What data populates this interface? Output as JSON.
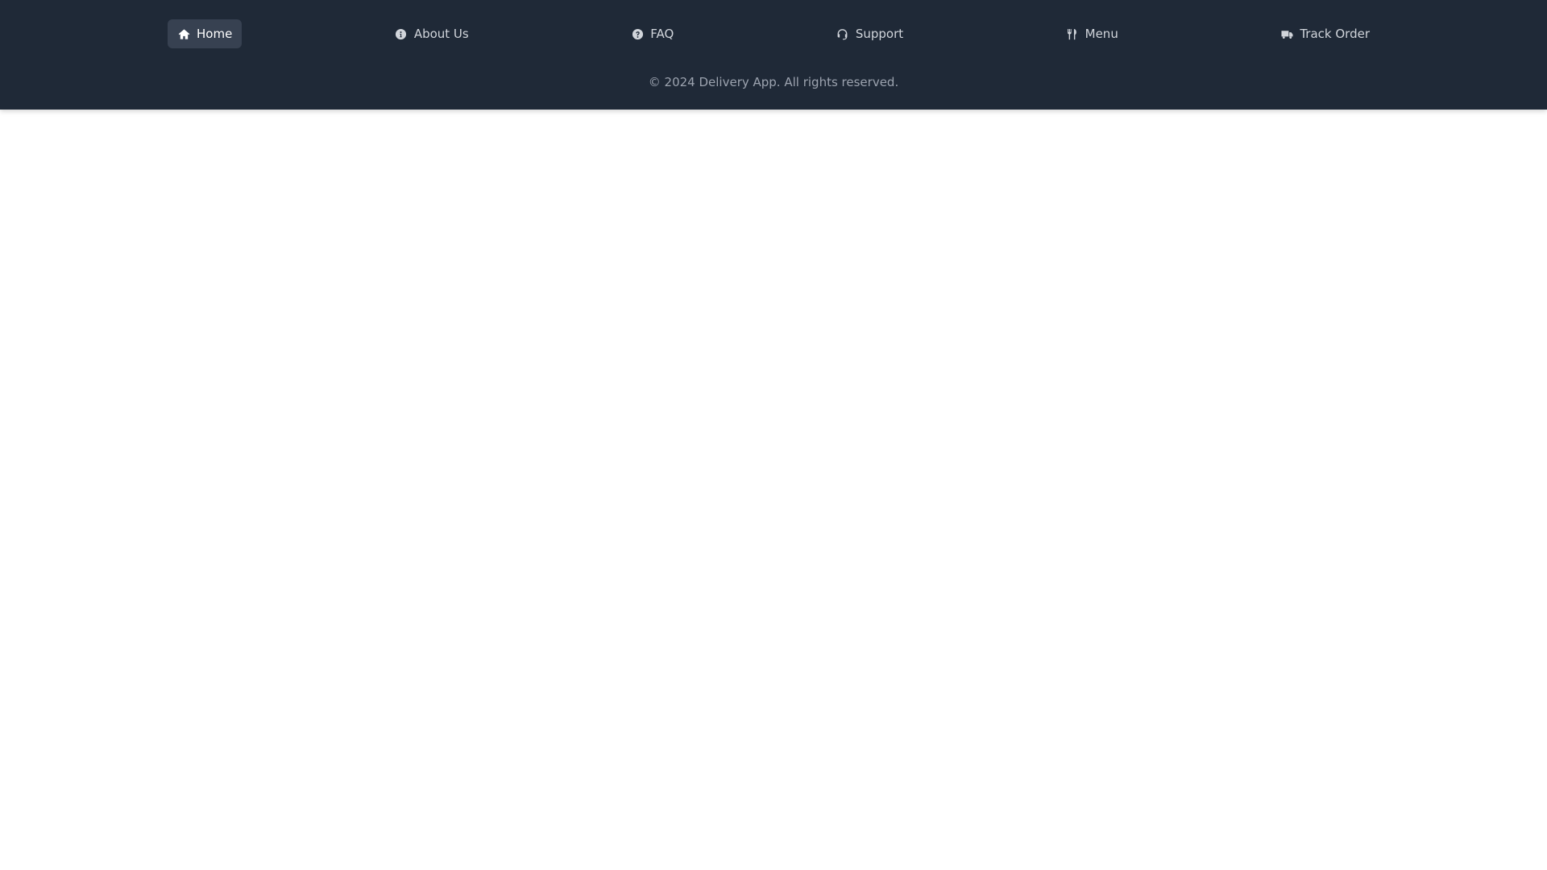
{
  "nav": {
    "items": [
      {
        "label": "Home",
        "icon": "home-icon",
        "active": true
      },
      {
        "label": "About Us",
        "icon": "info-icon",
        "active": false
      },
      {
        "label": "FAQ",
        "icon": "question-icon",
        "active": false
      },
      {
        "label": "Support",
        "icon": "headset-icon",
        "active": false
      },
      {
        "label": "Menu",
        "icon": "utensils-icon",
        "active": false
      },
      {
        "label": "Track Order",
        "icon": "truck-icon",
        "active": false
      }
    ]
  },
  "footer": {
    "copyright": "© 2024 Delivery App. All rights reserved."
  },
  "colors": {
    "bar_bg": "#1f2937",
    "active_bg": "#374151",
    "text": "#d1d5db",
    "muted": "#9ca3af"
  }
}
